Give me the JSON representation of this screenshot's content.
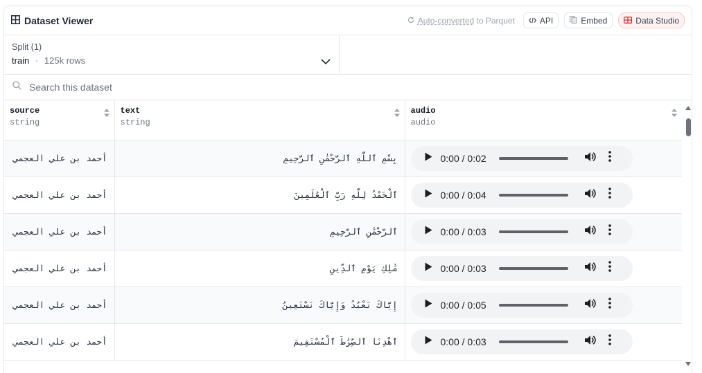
{
  "header": {
    "title": "Dataset Viewer",
    "auto_converted_link": "Auto-converted",
    "auto_converted_rest": " to Parquet",
    "api_label": "API",
    "embed_label": "Embed",
    "studio_label": "Data Studio",
    "studio_color": "#dc2626"
  },
  "split": {
    "label": "Split (1)",
    "name": "train",
    "separator": "·",
    "rows": "125k rows"
  },
  "search": {
    "placeholder": "Search this dataset"
  },
  "columns": [
    {
      "name": "source",
      "type": "string"
    },
    {
      "name": "text",
      "type": "string"
    },
    {
      "name": "audio",
      "type": "audio"
    }
  ],
  "rows": [
    {
      "source": "أحمد بن علي العجمي",
      "text": "بِسْمِ ٱللَّهِ ٱلرَّحْمَٰنِ ٱلرَّحِيمِ",
      "audio_time": "0:00 / 0:02"
    },
    {
      "source": "أحمد بن علي العجمي",
      "text": "ٱلْحَمْدُ لِلَّهِ رَبِّ ٱلْعَٰلَمِينَ",
      "audio_time": "0:00 / 0:04"
    },
    {
      "source": "أحمد بن علي العجمي",
      "text": "ٱلرَّحْمَٰنِ ٱلرَّحِيمِ",
      "audio_time": "0:00 / 0:03"
    },
    {
      "source": "أحمد بن علي العجمي",
      "text": "مَٰلِكِ يَوْمِ ٱلدِّينِ",
      "audio_time": "0:00 / 0:03"
    },
    {
      "source": "أحمد بن علي العجمي",
      "text": "إِيَّاكَ نَعْبُدُ وَإِيَّاكَ نَسْتَعِينُ",
      "audio_time": "0:00 / 0:05"
    },
    {
      "source": "أحمد بن علي العجمي",
      "text": "ٱهْدِنَا ٱلصِّرَٰطَ ٱلْمُسْتَقِيمَ",
      "audio_time": "0:00 / 0:03"
    }
  ]
}
